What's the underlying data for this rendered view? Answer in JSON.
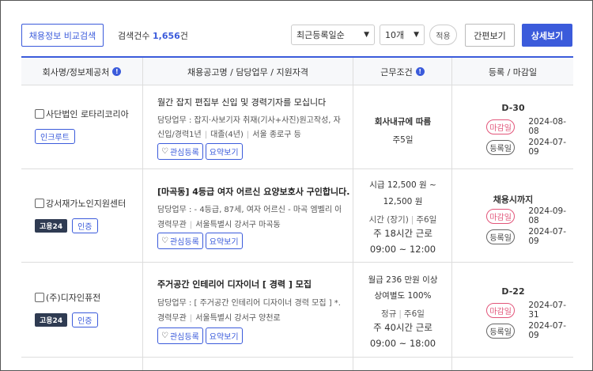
{
  "toolbar": {
    "compare_button": "채용정보 비교검색",
    "count_prefix": "검색건수",
    "count_value": "1,656",
    "count_suffix": "건",
    "sort_selected": "최근등록일순",
    "page_size_selected": "10개",
    "apply_button": "적용",
    "simple_view_button": "간편보기",
    "detail_view_button": "상세보기"
  },
  "table": {
    "headers": {
      "company": "회사명/정보제공처",
      "job": "채용공고명 / 담당업무 / 지원자격",
      "conditions": "근무조건",
      "dates": "등록 / 마감일"
    },
    "labels": {
      "interest": "관심등록",
      "summary": "요약보기",
      "deadline": "마감일",
      "registered": "등록일"
    },
    "rows": [
      {
        "company": "사단법인 로타리코리아",
        "badges": [
          "인크루트"
        ],
        "title": "월간 잡지 편집부 신입 및 경력기자를 모십니다",
        "duty": "담당업무 : 잡지·사보기자 취재(기사+사진)원고작성, 자...",
        "qual": [
          "신입/경력1년",
          "대졸(4년)",
          "서울 종로구 등"
        ],
        "cond": [
          "회사내규에 따름",
          "주5일"
        ],
        "dday": "D-30",
        "deadline_date": "2024-08-08",
        "reg_date": "2024-07-09"
      },
      {
        "company": "강서재가노인지원센터",
        "badges": [
          "고용24",
          "인증"
        ],
        "title": "[마곡동] 4등급 여자 어르신 요양보호사 구인합니다.",
        "duty": "담당업무 : - 4등급, 87세, 여자 어르신 - 마곡 엠벨리 아...",
        "qual": [
          "경력무관",
          "서울특별시 강서구 마곡동"
        ],
        "cond_wage1": "시급 12,500 원 ~",
        "cond_wage2": "12,500 원",
        "cond_type": "시간 (장기)",
        "cond_days": "주6일",
        "cond_hours": "주 18시간 근로",
        "cond_time": "09:00 ~ 12:00",
        "dday": "채용시까지",
        "deadline_date": "2024-09-08",
        "reg_date": "2024-07-09"
      },
      {
        "company": "(주)디자인퓨전",
        "badges": [
          "고용24",
          "인증"
        ],
        "title": "주거공간 인테리어 디자이너 [ 경력 ] 모집",
        "duty": "담당업무 : [ 주거공간 인테리어 디자이너 경력 모집 ] *...",
        "qual": [
          "경력무관",
          "서울특별시 강서구 양천로"
        ],
        "cond_wage1": "월급 236 만원 이상",
        "cond_wage2": "상여별도 100%",
        "cond_type": "정규",
        "cond_days": "주6일",
        "cond_hours": "주 40시간 근로",
        "cond_time": "09:00 ~ 18:00",
        "dday": "D-22",
        "deadline_date": "2024-07-31",
        "reg_date": "2024-07-09"
      }
    ]
  }
}
